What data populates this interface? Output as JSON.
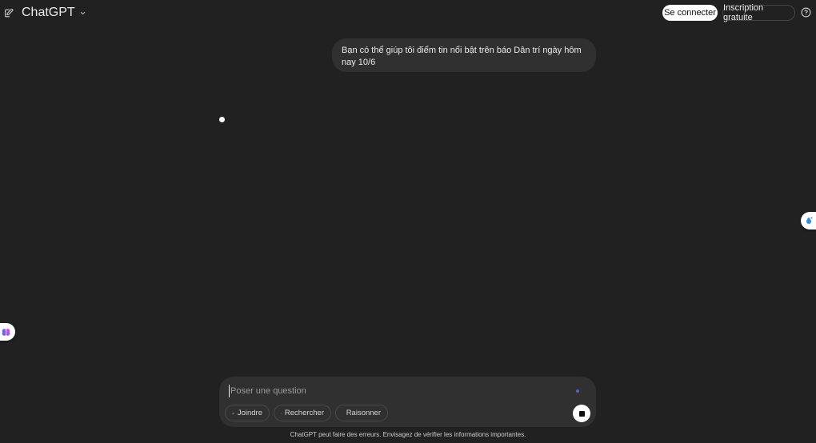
{
  "header": {
    "model_name": "ChatGPT",
    "login_label": "Se connecter",
    "signup_label": "Inscription gratuite"
  },
  "conversation": {
    "user_message": "Bạn có thể giúp tôi điểm tin nổi bật trên báo Dân trí ngày hôm nay 10/6"
  },
  "composer": {
    "placeholder": "Poser une question",
    "value": "",
    "tools": [
      {
        "label": "Joindre",
        "icon": "paperclip-icon"
      },
      {
        "label": "Rechercher",
        "icon": "globe-icon"
      },
      {
        "label": "Raisonner",
        "icon": "lightbulb-icon"
      }
    ],
    "stop_icon": "stop-icon"
  },
  "footer": {
    "disclaimer": "ChatGPT peut faire des erreurs. Envisagez de vérifier les informations importantes."
  },
  "colors": {
    "background": "#212121",
    "surface": "#303030",
    "text": "#ececec",
    "accent_dot": "#5b5bd6"
  }
}
